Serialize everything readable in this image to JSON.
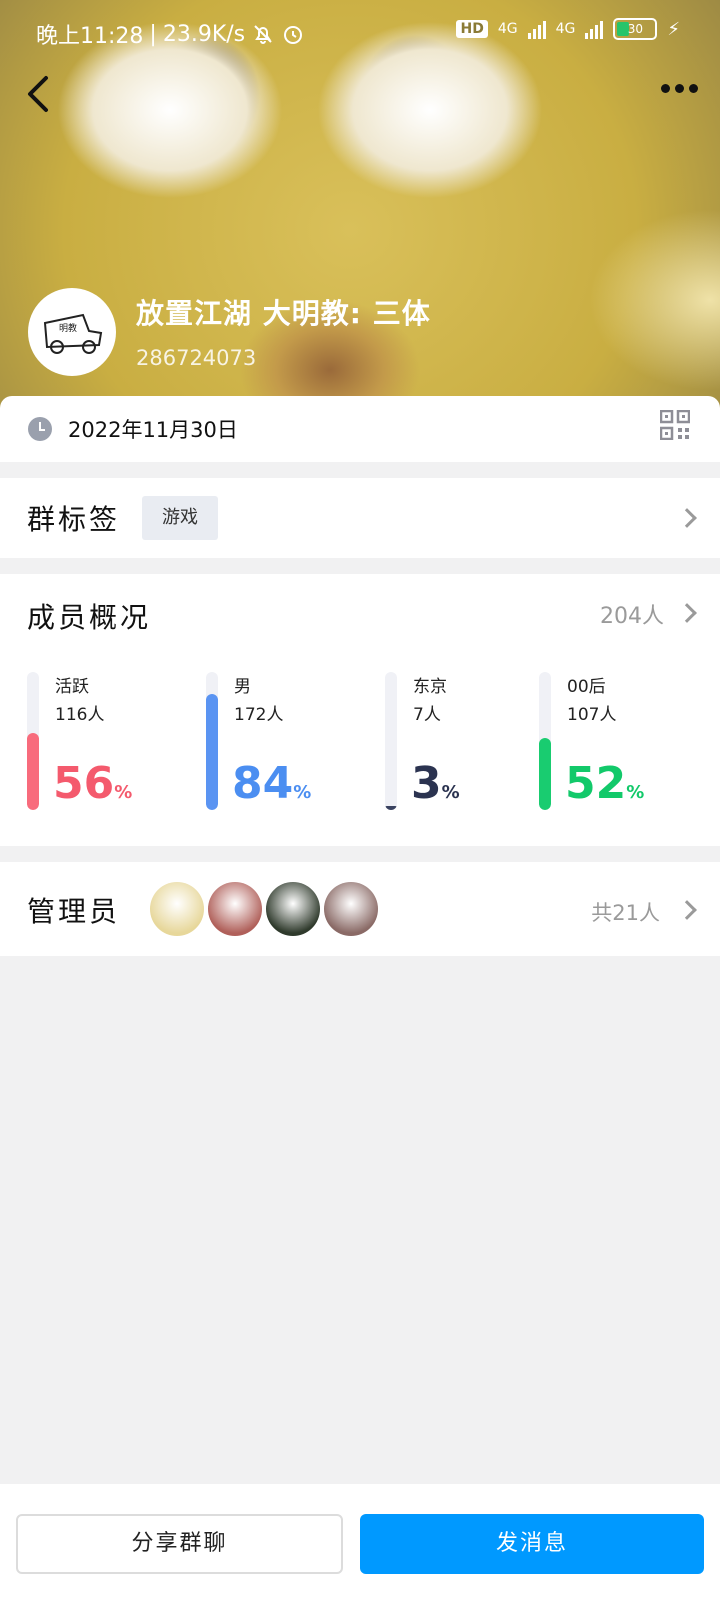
{
  "status_bar": {
    "time_label": "晚上11:28",
    "net_speed": "23.9K/s",
    "hd_badge": "HD",
    "network_1": "4G",
    "network_2": "4G",
    "battery": "30"
  },
  "group": {
    "name": "放置江湖 大明教: 三体",
    "id": "286724073",
    "avatar_text": "明教"
  },
  "created_date": "2022年11月30日",
  "tags": {
    "title": "群标签",
    "items": [
      "游戏"
    ]
  },
  "members": {
    "title": "成员概况",
    "total": "204人",
    "stats": [
      {
        "label": "活跃",
        "count": "116人",
        "percent": 56,
        "color": "#f45a6d",
        "track_fill": "#f86b7c"
      },
      {
        "label": "男",
        "count": "172人",
        "percent": 84,
        "color": "#4b8ef1",
        "track_fill": "#5a94f2"
      },
      {
        "label": "东京",
        "count": "7人",
        "percent": 3,
        "color": "#2b3350",
        "track_fill": "#3a4260"
      },
      {
        "label": "00后",
        "count": "107人",
        "percent": 52,
        "color": "#12c96a",
        "track_fill": "#19cc70"
      }
    ],
    "percent_sign": "%"
  },
  "admins": {
    "title": "管理员",
    "total": "共21人",
    "avatar_colors": [
      "#e7d79a",
      "#b0605a",
      "#2f3a2c",
      "#8a6a66"
    ]
  },
  "actions": {
    "share_label": "分享群聊",
    "send_label": "发消息"
  }
}
